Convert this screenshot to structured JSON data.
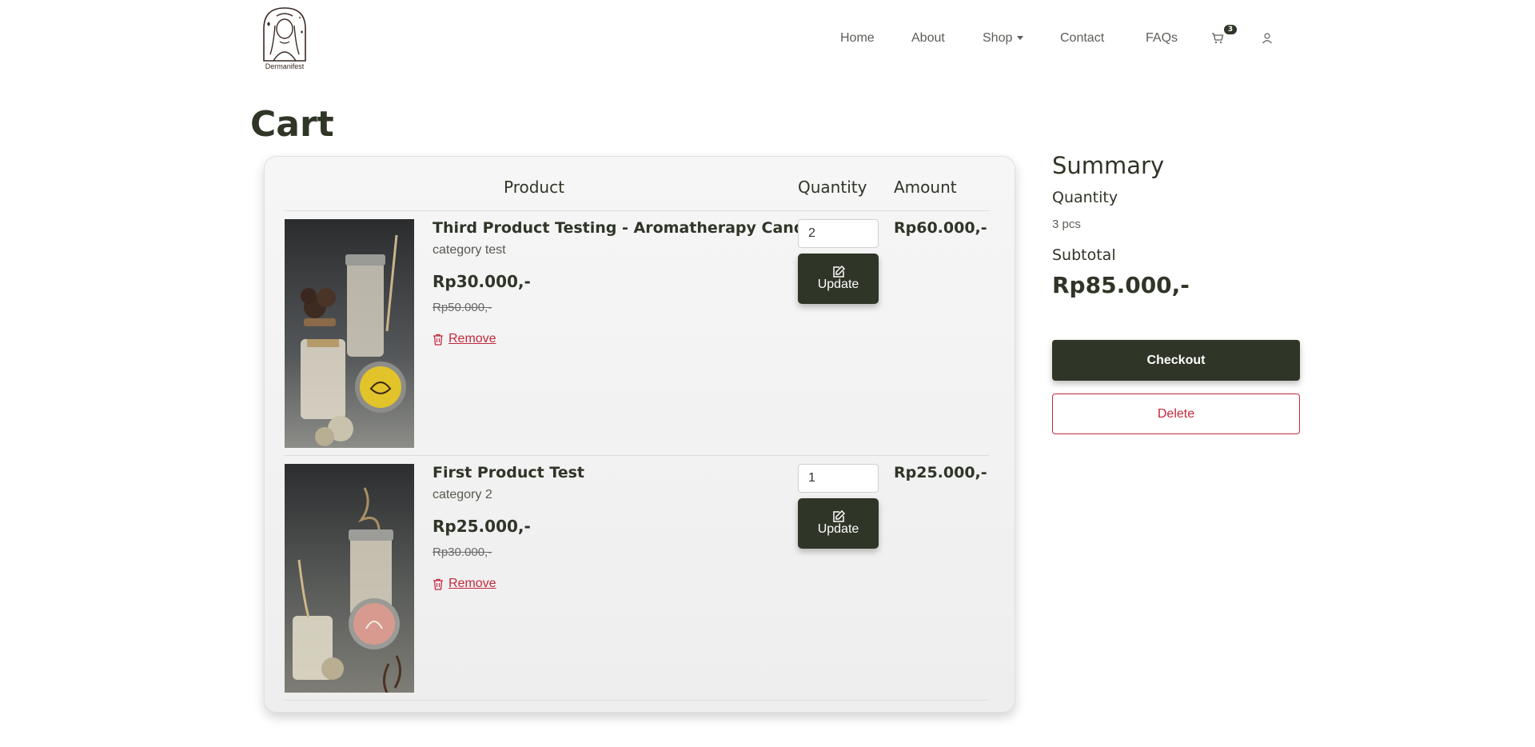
{
  "brand": {
    "name": "Dermanifest",
    "logo_icon": "woman-portrait-logo"
  },
  "nav": {
    "items": [
      "Home",
      "About",
      "Shop",
      "Contact",
      "FAQs"
    ],
    "cart_icon": "cart-icon",
    "cart_count": "3",
    "user_icon": "user-icon"
  },
  "page": {
    "title": "Cart"
  },
  "table": {
    "headers": {
      "product": "Product",
      "quantity": "Quantity",
      "amount": "Amount"
    },
    "update_label": "Update",
    "remove_label": "Remove",
    "rows": [
      {
        "name": "Third Product Testing - Aromatherapy Candle",
        "category": "category test",
        "price": "Rp30.000,-",
        "old_price": "Rp50.000,-",
        "quantity": "2",
        "amount": "Rp60.000,-",
        "image": "candle-jars-yellow-lid-photo"
      },
      {
        "name": "First Product Test",
        "category": "category 2",
        "price": "Rp25.000,-",
        "old_price": "Rp30.000,-",
        "quantity": "1",
        "amount": "Rp25.000,-",
        "image": "candle-jars-pink-lid-photo"
      }
    ]
  },
  "summary": {
    "title": "Summary",
    "quantity_label": "Quantity",
    "quantity_value": "3 pcs",
    "subtotal_label": "Subtotal",
    "subtotal_value": "Rp85.000,-",
    "checkout_label": "Checkout",
    "delete_label": "Delete"
  },
  "colors": {
    "primary": "#2f3527",
    "danger": "#c4283d",
    "card_bg": "#f2f2f2"
  }
}
